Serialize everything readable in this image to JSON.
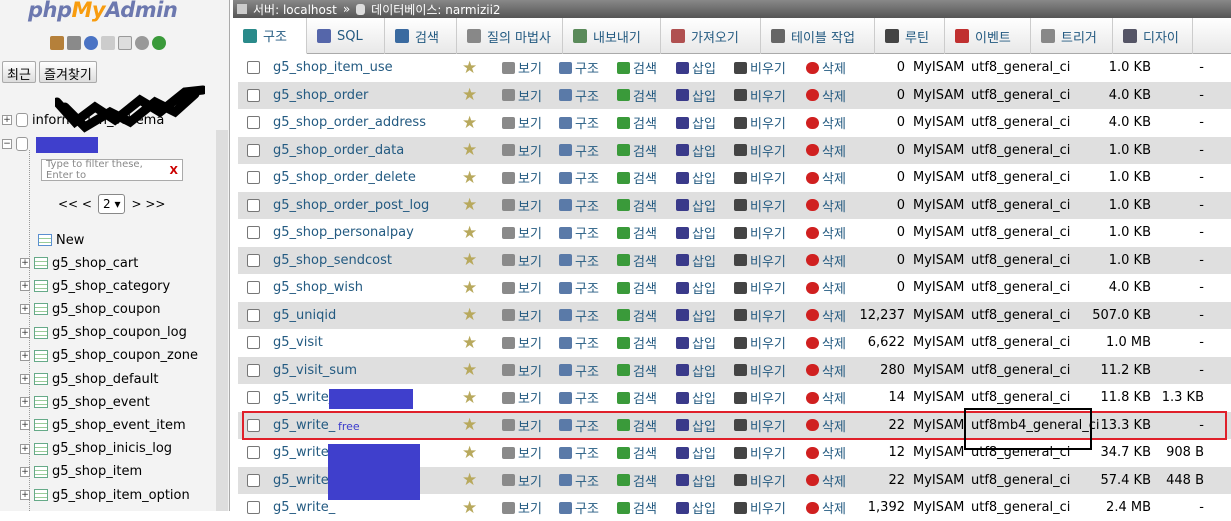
{
  "app": {
    "logo_php": "php",
    "logo_my": "My",
    "logo_admin": "Admin"
  },
  "nav": {
    "recent": "최근",
    "favorites": "즐겨찾기"
  },
  "tree": {
    "info_schema": "information_schema",
    "filter_placeholder": "Type to filter these, Enter to",
    "filter_clear": "X",
    "pager_prev": "<< <",
    "pager_page": "2",
    "pager_next": "> >>",
    "new_label": "New",
    "tables": [
      "g5_shop_cart",
      "g5_shop_category",
      "g5_shop_coupon",
      "g5_shop_coupon_log",
      "g5_shop_coupon_zone",
      "g5_shop_default",
      "g5_shop_event",
      "g5_shop_event_item",
      "g5_shop_inicis_log",
      "g5_shop_item",
      "g5_shop_item_option"
    ]
  },
  "breadcrumb": {
    "server": "서버: localhost",
    "sep": "»",
    "database": "데이터베이스: narmizii2"
  },
  "tabs": [
    {
      "label": "구조",
      "icon": "structure-icon"
    },
    {
      "label": "SQL",
      "icon": "sql-icon"
    },
    {
      "label": "검색",
      "icon": "search-icon"
    },
    {
      "label": "질의 마법사",
      "icon": "query-icon"
    },
    {
      "label": "내보내기",
      "icon": "export-icon"
    },
    {
      "label": "가져오기",
      "icon": "import-icon"
    },
    {
      "label": "테이블 작업",
      "icon": "operations-icon"
    },
    {
      "label": "루틴",
      "icon": "routines-icon"
    },
    {
      "label": "이벤트",
      "icon": "events-icon"
    },
    {
      "label": "트리거",
      "icon": "triggers-icon"
    },
    {
      "label": "디자이",
      "icon": "designer-icon"
    }
  ],
  "actions": {
    "browse": "보기",
    "structure": "구조",
    "search": "검색",
    "insert": "삽입",
    "empty": "비우기",
    "drop": "삭제"
  },
  "rows": [
    {
      "name": "g5_shop_item_use",
      "rows": "0",
      "engine": "MyISAM",
      "collation": "utf8_general_ci",
      "size": "1.0 KB",
      "overhead": "-"
    },
    {
      "name": "g5_shop_order",
      "rows": "0",
      "engine": "MyISAM",
      "collation": "utf8_general_ci",
      "size": "4.0 KB",
      "overhead": "-"
    },
    {
      "name": "g5_shop_order_address",
      "rows": "0",
      "engine": "MyISAM",
      "collation": "utf8_general_ci",
      "size": "4.0 KB",
      "overhead": "-"
    },
    {
      "name": "g5_shop_order_data",
      "rows": "0",
      "engine": "MyISAM",
      "collation": "utf8_general_ci",
      "size": "1.0 KB",
      "overhead": "-"
    },
    {
      "name": "g5_shop_order_delete",
      "rows": "0",
      "engine": "MyISAM",
      "collation": "utf8_general_ci",
      "size": "1.0 KB",
      "overhead": "-"
    },
    {
      "name": "g5_shop_order_post_log",
      "rows": "0",
      "engine": "MyISAM",
      "collation": "utf8_general_ci",
      "size": "1.0 KB",
      "overhead": "-"
    },
    {
      "name": "g5_shop_personalpay",
      "rows": "0",
      "engine": "MyISAM",
      "collation": "utf8_general_ci",
      "size": "1.0 KB",
      "overhead": "-"
    },
    {
      "name": "g5_shop_sendcost",
      "rows": "0",
      "engine": "MyISAM",
      "collation": "utf8_general_ci",
      "size": "1.0 KB",
      "overhead": "-"
    },
    {
      "name": "g5_shop_wish",
      "rows": "0",
      "engine": "MyISAM",
      "collation": "utf8_general_ci",
      "size": "4.0 KB",
      "overhead": "-"
    },
    {
      "name": "g5_uniqid",
      "rows": "12,237",
      "engine": "MyISAM",
      "collation": "utf8_general_ci",
      "size": "507.0 KB",
      "overhead": "-"
    },
    {
      "name": "g5_visit",
      "rows": "6,622",
      "engine": "MyISAM",
      "collation": "utf8_general_ci",
      "size": "1.0 MB",
      "overhead": "-"
    },
    {
      "name": "g5_visit_sum",
      "rows": "280",
      "engine": "MyISAM",
      "collation": "utf8_general_ci",
      "size": "11.2 KB",
      "overhead": "-"
    },
    {
      "name": "g5_write_",
      "rows": "14",
      "engine": "MyISAM",
      "collation": "utf8_general_ci",
      "size": "11.8 KB",
      "overhead": "1.3 KB"
    },
    {
      "name": "g5_write_",
      "suffix": "free",
      "rows": "22",
      "engine": "MyISAM",
      "collation": "utf8mb4_general_ci",
      "size": "13.3 KB",
      "overhead": "-"
    },
    {
      "name": "g5_write_",
      "rows": "12",
      "engine": "MyISAM",
      "collation": "utf8_general_ci",
      "size": "34.7 KB",
      "overhead": "908 B"
    },
    {
      "name": "g5_write_",
      "rows": "22",
      "engine": "MyISAM",
      "collation": "utf8_general_ci",
      "size": "57.4 KB",
      "overhead": "448 B"
    },
    {
      "name": "g5_write_",
      "rows": "1,392",
      "engine": "MyISAM",
      "collation": "utf8_general_ci",
      "size": "2.4 MB",
      "overhead": "-"
    }
  ]
}
